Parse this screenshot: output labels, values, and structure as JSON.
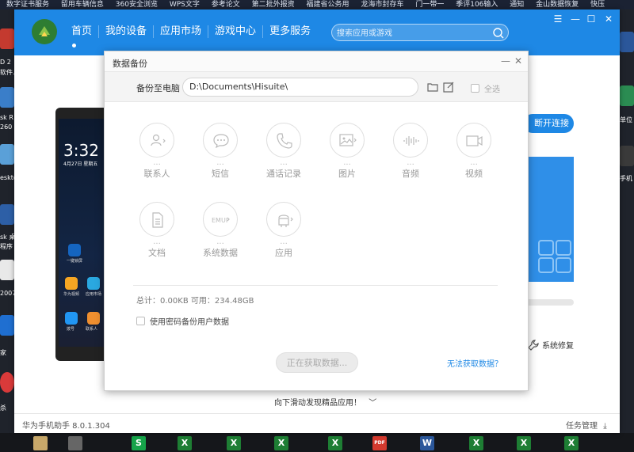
{
  "desktop": {
    "top_bar_items": [
      "数字证书服务",
      "留用车辆信息",
      "360安全浏览",
      "WPS文字",
      "参考论文",
      "第二批外报资",
      "福建省公务用",
      "龙海市封存车",
      "门一带一",
      "季评106输入",
      "通知",
      "金山数据恢复",
      "快压"
    ],
    "left_labels": [
      "D 2",
      "软件.",
      "sk R",
      "260",
      "eskto",
      "sk 桌",
      "程序",
      "2007",
      "家",
      "杀"
    ],
    "right_labels": [
      "单位",
      "手机"
    ],
    "taskbar_icons": [
      "S",
      "X",
      "X",
      "X",
      "X",
      "PDF",
      "W",
      "X",
      "X",
      "X"
    ]
  },
  "app": {
    "nav": [
      "首页",
      "我的设备",
      "应用市场",
      "游戏中心",
      "更多服务"
    ],
    "search_placeholder": "搜索应用或游戏",
    "disconnect_label": "断开连接",
    "repair_label": "系统修复",
    "scroll_hint": "向下滑动发现精品应用！",
    "version": "华为手机助手 8.0.1.304",
    "task_mgr": "任务管理",
    "phone": {
      "time": "3:32",
      "date": "4月27日 星期五",
      "apps": [
        "一键锁屏",
        "华为视频",
        "应用市场",
        "拨号",
        "联系人"
      ]
    }
  },
  "dialog": {
    "title": "数据备份",
    "backup_to_label": "备份至电脑",
    "path": "D:\\Documents\\Hisuite\\",
    "select_all": "全选",
    "categories": [
      {
        "name": "联系人",
        "dots": "...",
        "icon": "contact-icon"
      },
      {
        "name": "短信",
        "dots": "...",
        "icon": "sms-icon"
      },
      {
        "name": "通话记录",
        "dots": "...",
        "icon": "call-log-icon"
      },
      {
        "name": "图片",
        "dots": "...",
        "icon": "picture-icon"
      },
      {
        "name": "音频",
        "dots": "...",
        "icon": "audio-icon"
      },
      {
        "name": "视频",
        "dots": "...",
        "icon": "video-icon"
      },
      {
        "name": "文档",
        "dots": "...",
        "icon": "document-icon"
      },
      {
        "name": "系统数据",
        "dots": "...",
        "icon": "emui-icon"
      },
      {
        "name": "应用",
        "dots": "...",
        "icon": "android-icon"
      }
    ],
    "storage_text": "总计：0.00KB  可用：234.48GB",
    "encrypt_label": "使用密码备份用户数据",
    "action_button": "正在获取数据...",
    "help_link": "无法获取数据？"
  },
  "colors": {
    "accent": "#1e88e5",
    "header": "#1e88e5"
  }
}
